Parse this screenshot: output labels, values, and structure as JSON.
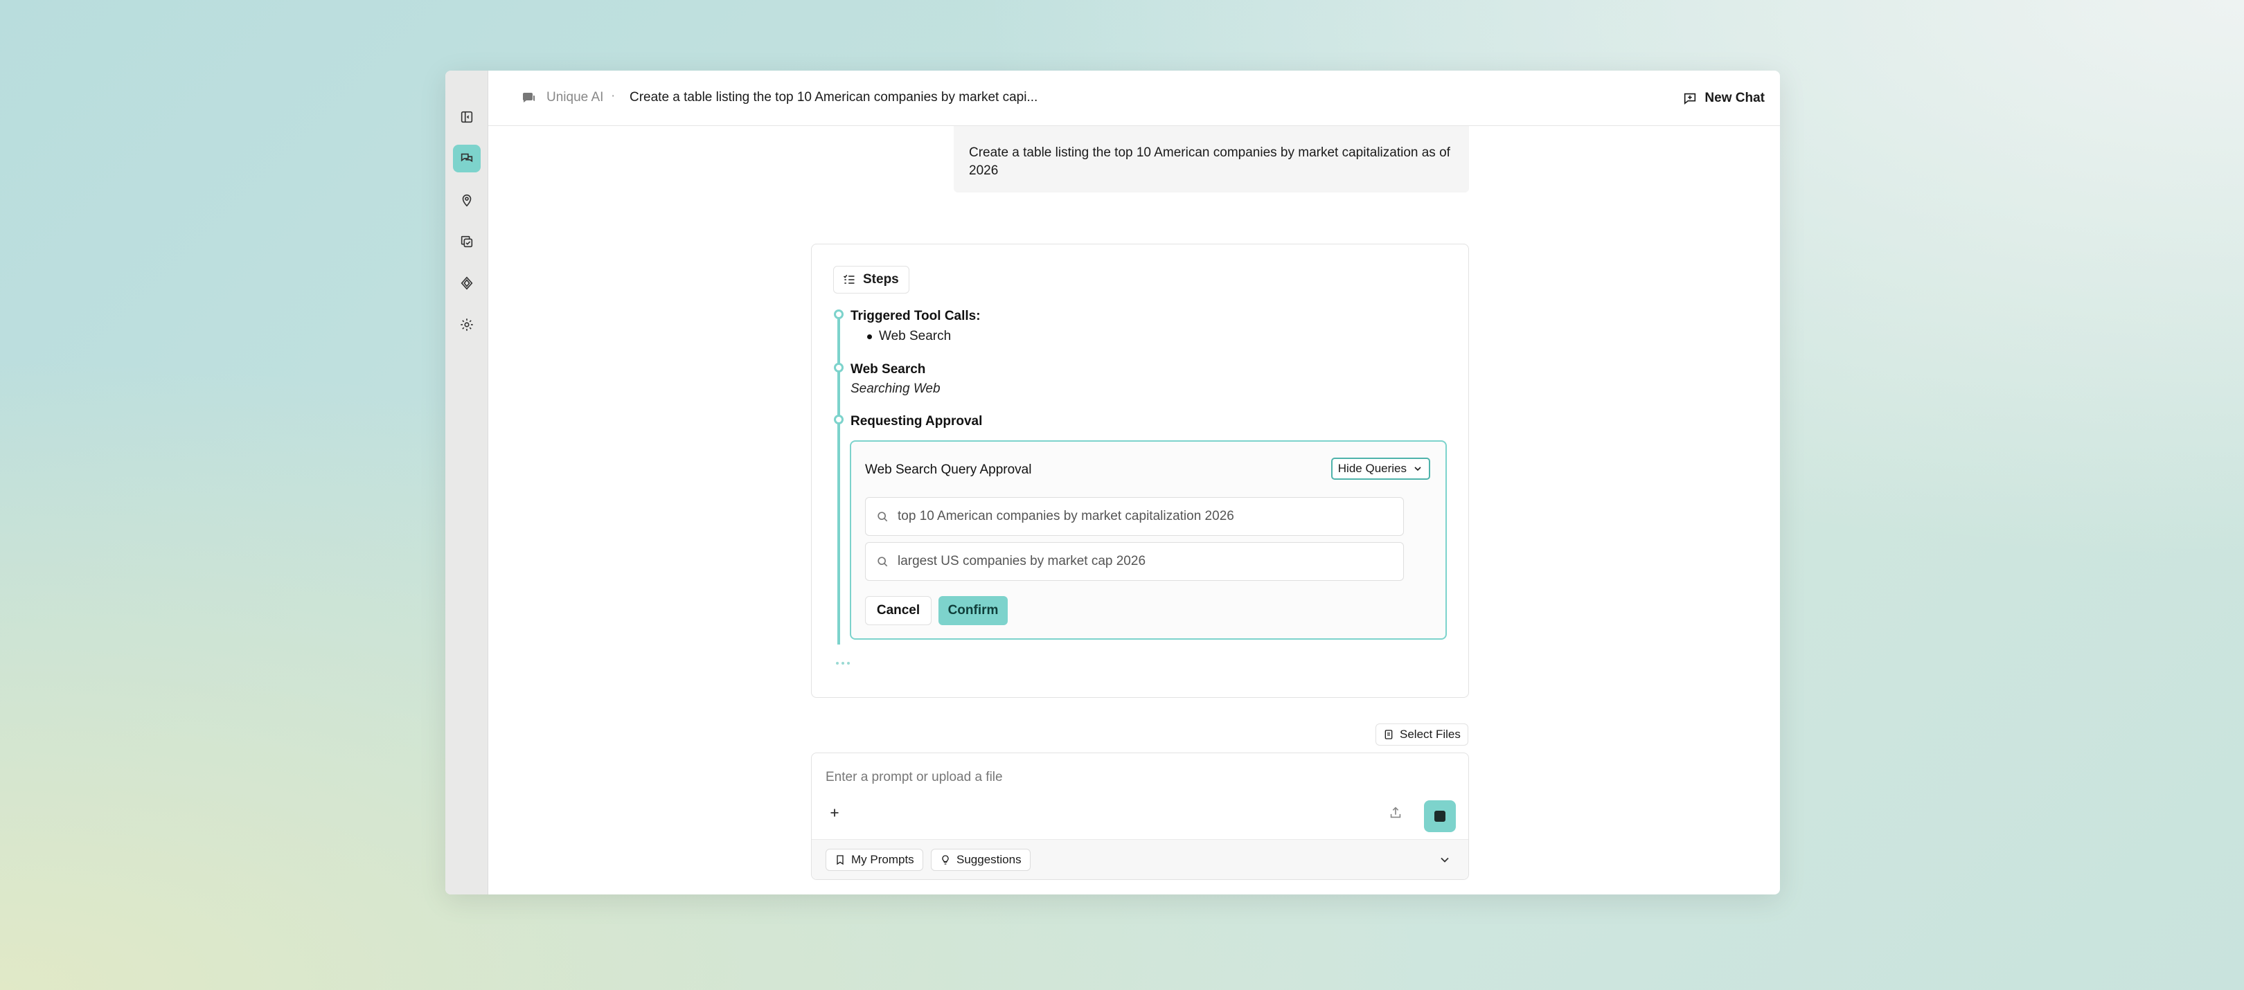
{
  "header": {
    "app_name": "Unique AI",
    "separator": "·",
    "chat_title": "Create a table listing the top 10 American companies by market capi...",
    "new_chat_label": "New Chat"
  },
  "sidebar": {
    "items": [
      {
        "name": "sidebar-toggle",
        "icon": "panel-left-icon",
        "active": false
      },
      {
        "name": "chats",
        "icon": "chat-bubbles-icon",
        "active": true
      },
      {
        "name": "explore",
        "icon": "location-icon",
        "active": false
      },
      {
        "name": "documents",
        "icon": "copy-icon",
        "active": false
      },
      {
        "name": "spaces",
        "icon": "diamond-icon",
        "active": false
      },
      {
        "name": "settings",
        "icon": "gear-icon",
        "active": false
      }
    ]
  },
  "user_message": "Create a table listing the top 10 American companies by market capitalization as of 2026",
  "steps": {
    "button_label": "Steps",
    "items": [
      {
        "title": "Triggered Tool Calls:",
        "bullets": [
          "Web Search"
        ]
      },
      {
        "title": "Web Search",
        "subtitle": "Searching Web"
      },
      {
        "title": "Requesting Approval"
      }
    ]
  },
  "approval": {
    "title": "Web Search Query Approval",
    "toggle_label": "Hide Queries",
    "queries": [
      "top 10 American companies by market capitalization 2026",
      "largest US companies by market cap 2026"
    ],
    "cancel_label": "Cancel",
    "confirm_label": "Confirm"
  },
  "composer": {
    "select_files_label": "Select Files",
    "placeholder": "Enter a prompt or upload a file",
    "my_prompts_label": "My Prompts",
    "suggestions_label": "Suggestions"
  },
  "colors": {
    "accent": "#7dd3cc",
    "accent_border": "#4fb3ab"
  }
}
